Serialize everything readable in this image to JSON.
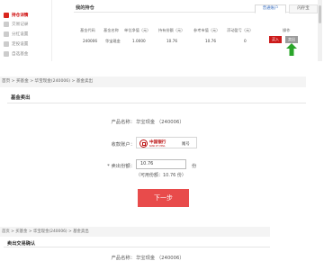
{
  "holdings": {
    "sidebar": [
      {
        "label": "持仓详情",
        "active": true
      },
      {
        "label": "交易记录",
        "active": false
      },
      {
        "label": "分红设置",
        "active": false
      },
      {
        "label": "定投设置",
        "active": false
      },
      {
        "label": "自选基金",
        "active": false
      }
    ],
    "title": "我的持仓",
    "tabs": [
      "普通账户",
      "闪存宝"
    ],
    "columns": [
      "基金代码",
      "基金名称",
      "单位净值（元）",
      "持有份额（元）",
      "参考市值（元）",
      "浮动盈亏（元）",
      "操作"
    ],
    "row": {
      "code": "240006",
      "name": "华宝现金",
      "nav": "1.0000",
      "shares": "10.76",
      "market_value": "10.76",
      "pnl": "0"
    },
    "buy_label": "买入",
    "sell_label": "卖出"
  },
  "sell_form": {
    "breadcrumb": "首页 > 买基金 > 华宝现金(240006) > 基金卖出",
    "title": "基金卖出",
    "product_label": "产品名称：",
    "product_value": "华宝现金 （240006）",
    "account_label": "收款账户：",
    "bank_name": "中国银行",
    "bank_sub": "BANK OF CHINA",
    "card_text": "尾号",
    "qty_label": "* 卖出份额：",
    "qty_value": "10.76",
    "qty_unit": "份",
    "available_text": "（可用份额：10.76 份）",
    "next_label": "下一步"
  },
  "confirm": {
    "breadcrumb": "首页 > 买基金 > 华宝现金(240006) > 基金卖出",
    "title": "卖出交易确认",
    "product_label": "产品名称：",
    "product_value": "华宝现金 （240006）"
  },
  "colors": {
    "accent_red": "#cc1a1a",
    "next_button": "#e84b4b",
    "arrow_green": "#2aa52a",
    "tab_blue": "#3a6fc0"
  }
}
